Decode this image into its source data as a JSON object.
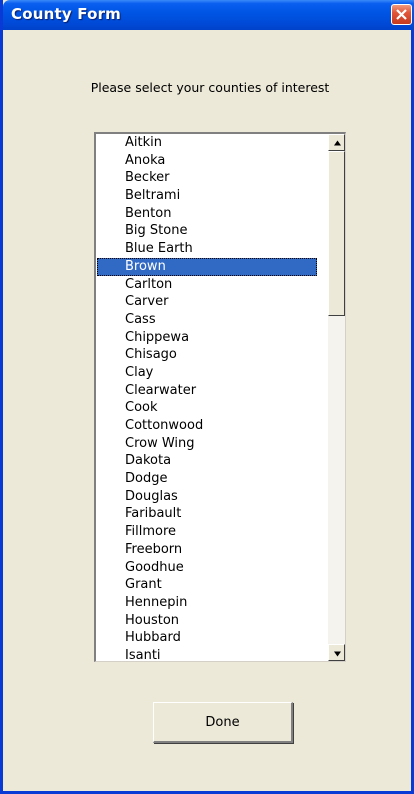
{
  "window": {
    "title": "County Form"
  },
  "prompt_text": "Please select your counties of interest",
  "counties": [
    "Aitkin",
    "Anoka",
    "Becker",
    "Beltrami",
    "Benton",
    "Big Stone",
    "Blue Earth",
    "Brown",
    "Carlton",
    "Carver",
    "Cass",
    "Chippewa",
    "Chisago",
    "Clay",
    "Clearwater",
    "Cook",
    "Cottonwood",
    "Crow Wing",
    "Dakota",
    "Dodge",
    "Douglas",
    "Faribault",
    "Fillmore",
    "Freeborn",
    "Goodhue",
    "Grant",
    "Hennepin",
    "Houston",
    "Hubbard",
    "Isanti"
  ],
  "selected_county": "Brown",
  "done_label": "Done",
  "icons": {
    "close": "close-icon",
    "scroll_up": "scroll-up-arrow-icon",
    "scroll_down": "scroll-down-arrow-icon"
  },
  "colors": {
    "titlebar": "#0054e3",
    "selection": "#316ac5",
    "close_button": "#e0563a",
    "dialog_background": "#ece9d8"
  }
}
